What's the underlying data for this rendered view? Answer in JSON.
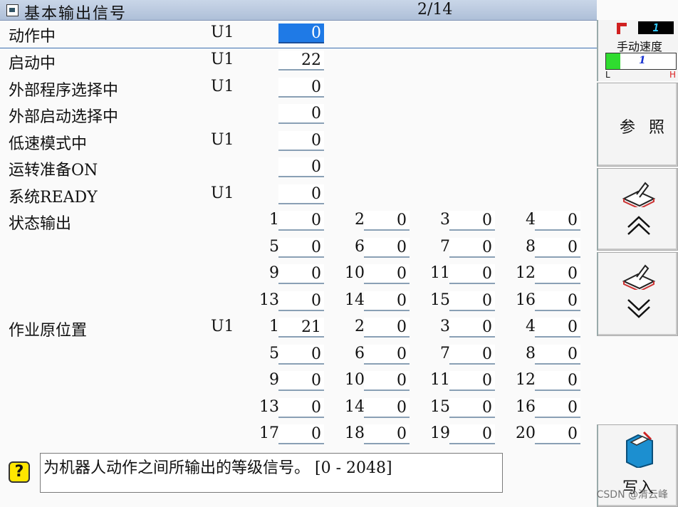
{
  "window": {
    "title": "基本输出信号",
    "page": "2/14"
  },
  "rows": [
    {
      "label": "动作中",
      "unit": "U1",
      "value": "0"
    },
    {
      "label": "启动中",
      "unit": "U1",
      "value": "22"
    },
    {
      "label": "外部程序选择中",
      "unit": "U1",
      "value": "0"
    },
    {
      "label": "外部启动选择中",
      "unit": "",
      "value": "0"
    },
    {
      "label": "低速模式中",
      "unit": "U1",
      "value": "0"
    },
    {
      "label": "运转准备ON",
      "unit": "",
      "value": "0"
    },
    {
      "label": "系统READY",
      "unit": "U1",
      "value": "0"
    }
  ],
  "state_output": {
    "label": "状态输出",
    "cells": [
      {
        "n": "1",
        "v": "0"
      },
      {
        "n": "2",
        "v": "0"
      },
      {
        "n": "3",
        "v": "0"
      },
      {
        "n": "4",
        "v": "0"
      },
      {
        "n": "5",
        "v": "0"
      },
      {
        "n": "6",
        "v": "0"
      },
      {
        "n": "7",
        "v": "0"
      },
      {
        "n": "8",
        "v": "0"
      },
      {
        "n": "9",
        "v": "0"
      },
      {
        "n": "10",
        "v": "0"
      },
      {
        "n": "11",
        "v": "0"
      },
      {
        "n": "12",
        "v": "0"
      },
      {
        "n": "13",
        "v": "0"
      },
      {
        "n": "14",
        "v": "0"
      },
      {
        "n": "15",
        "v": "0"
      },
      {
        "n": "16",
        "v": "0"
      }
    ]
  },
  "work_home": {
    "label": "作业原位置",
    "unit": "U1",
    "cells": [
      {
        "n": "1",
        "v": "21"
      },
      {
        "n": "2",
        "v": "0"
      },
      {
        "n": "3",
        "v": "0"
      },
      {
        "n": "4",
        "v": "0"
      },
      {
        "n": "5",
        "v": "0"
      },
      {
        "n": "6",
        "v": "0"
      },
      {
        "n": "7",
        "v": "0"
      },
      {
        "n": "8",
        "v": "0"
      },
      {
        "n": "9",
        "v": "0"
      },
      {
        "n": "10",
        "v": "0"
      },
      {
        "n": "11",
        "v": "0"
      },
      {
        "n": "12",
        "v": "0"
      },
      {
        "n": "13",
        "v": "0"
      },
      {
        "n": "14",
        "v": "0"
      },
      {
        "n": "15",
        "v": "0"
      },
      {
        "n": "16",
        "v": "0"
      },
      {
        "n": "17",
        "v": "0"
      },
      {
        "n": "18",
        "v": "0"
      },
      {
        "n": "19",
        "v": "0"
      },
      {
        "n": "20",
        "v": "0"
      }
    ]
  },
  "sidebar": {
    "tool_number": "1",
    "speed_label": "手动速度",
    "speed_marker": "1",
    "speed_low": "L",
    "speed_high": "H",
    "speed_level_fraction": 0.2,
    "ref_button": "参 照",
    "write_button": "写入",
    "icons": [
      "tool-icon",
      "book-up-icon",
      "chevron-up-icon",
      "book-down-icon",
      "chevron-down-icon",
      "folder-write-icon"
    ]
  },
  "status": {
    "message": "为机器人动作之间所输出的等级信号。    [0 - 2048]",
    "help_icon": "?"
  },
  "watermark": "CSDN @清云峰",
  "colors": {
    "selected_field": "#1f7ae6",
    "speed_fill": "#2fdc2f",
    "title_bg": "#b9c8de"
  }
}
